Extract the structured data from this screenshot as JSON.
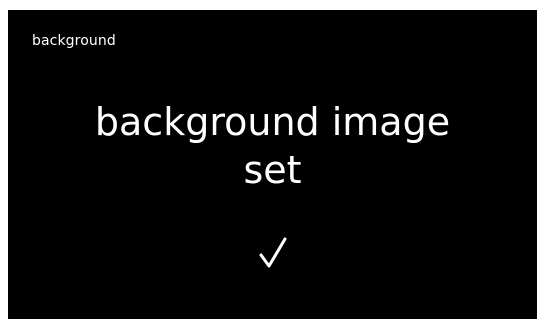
{
  "header": {
    "title": "background"
  },
  "message": {
    "line1": "background image",
    "line2": "set"
  },
  "status": {
    "icon": "checkmark-icon"
  },
  "colors": {
    "background": "#000000",
    "text": "#ffffff"
  }
}
